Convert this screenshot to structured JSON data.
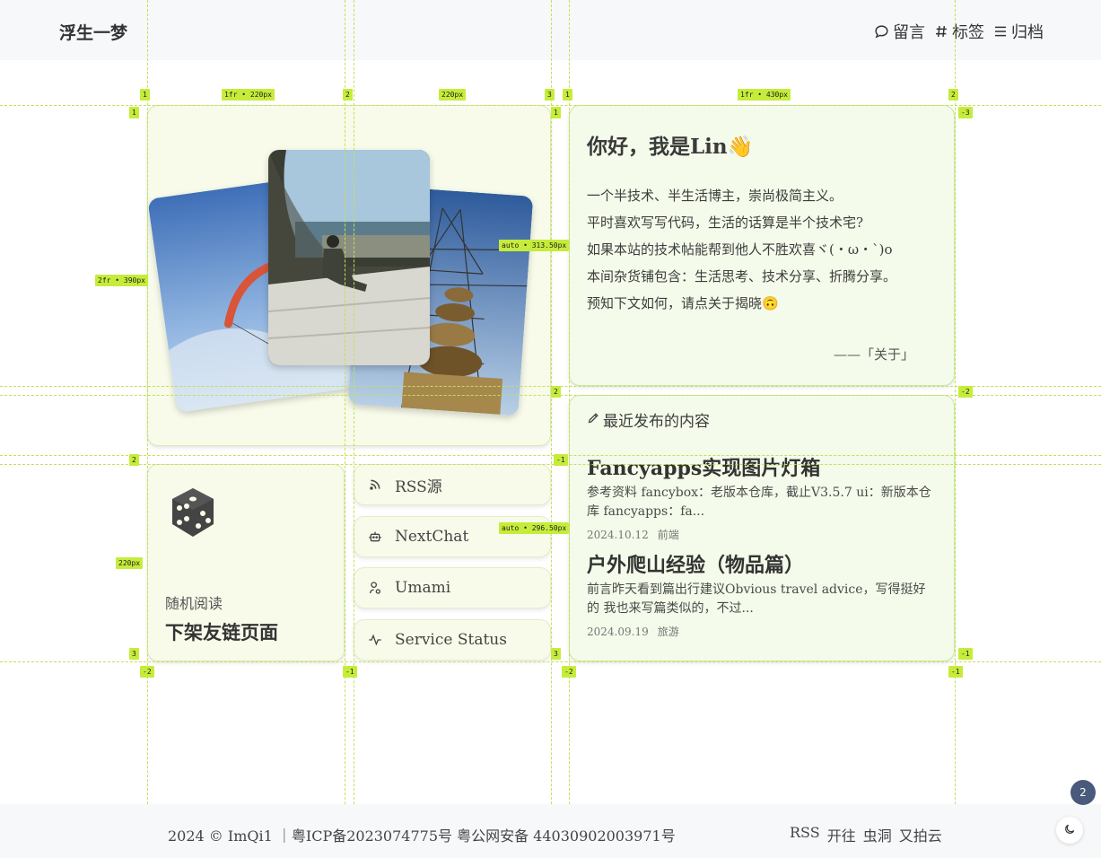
{
  "header": {
    "site_title": "浮生一梦",
    "nav": [
      {
        "icon": "message-bubble-icon",
        "label": "留言"
      },
      {
        "icon": "hash-icon",
        "label": "标签"
      },
      {
        "icon": "menu-lines-icon",
        "label": "归档"
      }
    ]
  },
  "grid_overlay": {
    "labels": {
      "col_top_1": "1",
      "col_top_2": "2",
      "col_top_3": "3",
      "col_size_1": "1fr • 220px",
      "col_size_2": "220px",
      "rcol_top_1": "1",
      "rcol_top_2": "2",
      "rcol_size": "1fr • 430px",
      "row_size_1": "2fr • 390px",
      "row_size_2": "220px",
      "row_1": "1",
      "row_2": "2",
      "row_3": "3",
      "rrow_1": "1",
      "rrow_2": "2",
      "rrow_3": "3",
      "neg_row_3": "-3",
      "neg_row_2": "-2",
      "neg_row_1": "-1",
      "mid_neg_1": "-1",
      "auto_1": "auto • 313.50px",
      "auto_2": "auto • 296.50px",
      "bottom_neg_2": "-2",
      "bottom_neg_1": "-1",
      "bottom_r_neg_2": "-2",
      "bottom_r_neg_1": "-1"
    }
  },
  "intro": {
    "title": "你好，我是Lin👋",
    "lines": [
      "一个半技术、半生活博主，崇尚极简主义。",
      "平时喜欢写写代码，生活的话算是半个技术宅?",
      "如果本站的技术帖能帮到他人不胜欢喜ヾ(・ω・`)o",
      "本间杂货铺包含：生活思考、技术分享、折腾分享。",
      "预知下文如何，请点关于揭晓🙃"
    ],
    "signature": "——「关于」"
  },
  "recent": {
    "heading": "最近发布的内容",
    "posts": [
      {
        "title": "Fancyapps实现图片灯箱",
        "excerpt": "参考资料 fancybox：老版本仓库，截止V3.5.7 ui：新版本仓库 fancyapps：fa...",
        "date": "2024.10.12",
        "category": "前端"
      },
      {
        "title": "户外爬山经验（物品篇）",
        "excerpt": "前言昨天看到篇出行建议Obvious travel advice，写得挺好的 我也来写篇类似的，不过...",
        "date": "2024.09.19",
        "category": "旅游"
      }
    ]
  },
  "random": {
    "label": "随机阅读",
    "title": "下架友链页面"
  },
  "links": [
    {
      "icon": "rss-icon",
      "label": "RSS源"
    },
    {
      "icon": "robot-icon",
      "label": "NextChat"
    },
    {
      "icon": "user-chart-icon",
      "label": "Umami"
    },
    {
      "icon": "pulse-icon",
      "label": "Service Status"
    }
  ],
  "footer": {
    "copyright": "2024 © ImQi1 ｜粤ICP备2023074775号 粤公网安备 44030902003971号",
    "links": [
      "RSS",
      "开往",
      "虫洞",
      "又拍云"
    ],
    "badge_count": "2"
  },
  "colors": {
    "accent_grid": "#c6ec3a",
    "card_bg": "#f8fbea",
    "badge_bg": "#4a5a7c"
  }
}
